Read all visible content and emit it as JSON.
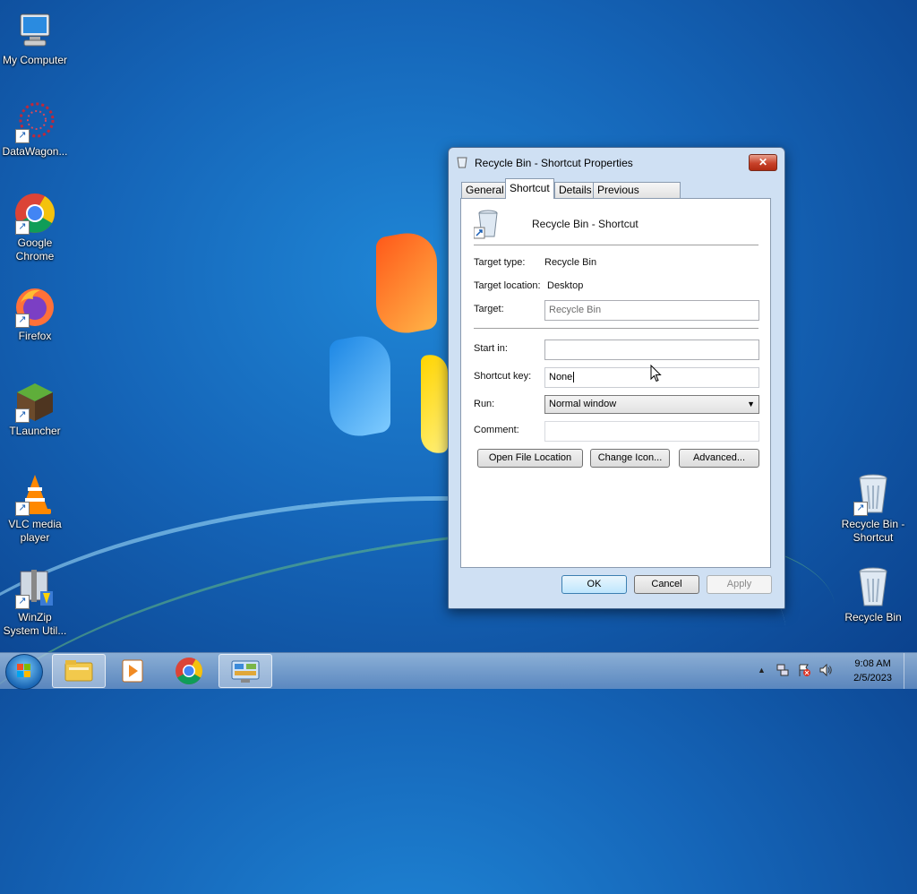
{
  "desktop": {
    "icons_left": [
      {
        "label": "My Computer"
      },
      {
        "label": "DataWagon..."
      },
      {
        "label": "Google Chrome"
      },
      {
        "label": "Firefox"
      },
      {
        "label": "TLauncher"
      },
      {
        "label": "VLC media player"
      },
      {
        "label": "WinZip System Util..."
      }
    ],
    "icons_right": [
      {
        "label": "Recycle Bin - Shortcut"
      },
      {
        "label": "Recycle Bin"
      }
    ]
  },
  "dialog": {
    "title": "Recycle Bin - Shortcut Properties",
    "close_label": "✕",
    "tabs": [
      {
        "label": "General"
      },
      {
        "label": "Shortcut"
      },
      {
        "label": "Details"
      },
      {
        "label": "Previous Versions"
      }
    ],
    "active_tab": "Shortcut",
    "shortcut_name": "Recycle Bin - Shortcut",
    "target_type_label": "Target type:",
    "target_type_value": "Recycle Bin",
    "target_location_label": "Target location:",
    "target_location_value": "Desktop",
    "target_label": "Target:",
    "target_value": "Recycle Bin",
    "start_in_label": "Start in:",
    "start_in_value": "",
    "shortcut_key_label": "Shortcut key:",
    "shortcut_key_value": "None",
    "run_label": "Run:",
    "run_value": "Normal window",
    "comment_label": "Comment:",
    "comment_value": "",
    "open_file_location": "Open File Location",
    "change_icon": "Change Icon...",
    "advanced": "Advanced...",
    "ok": "OK",
    "cancel": "Cancel",
    "apply": "Apply"
  },
  "taskbar": {
    "time": "9:08 AM",
    "date": "2/5/2023",
    "tray_up_arrow": "▲"
  }
}
